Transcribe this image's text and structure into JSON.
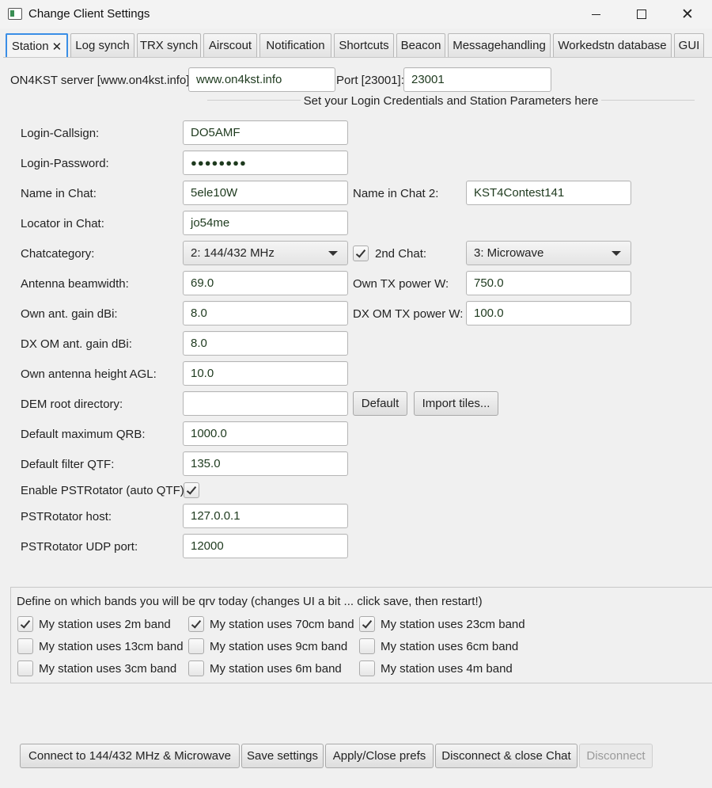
{
  "window": {
    "title": "Change Client Settings"
  },
  "tabs": [
    {
      "label": "Station"
    },
    {
      "label": "Log synch"
    },
    {
      "label": "TRX synch"
    },
    {
      "label": "Airscout"
    },
    {
      "label": "Notification"
    },
    {
      "label": "Shortcuts"
    },
    {
      "label": "Beacon"
    },
    {
      "label": "Messagehandling"
    },
    {
      "label": "Workedstn database"
    },
    {
      "label": "GUI"
    }
  ],
  "server": {
    "server_label": "ON4KST server [www.on4kst.info]:",
    "server_value": "www.on4kst.info",
    "port_label": "Port [23001]:",
    "port_value": "23001"
  },
  "section_title": "Set your Login Credentials and Station Parameters here",
  "fields": {
    "login_callsign": {
      "label": "Login-Callsign:",
      "value": "DO5AMF"
    },
    "login_password": {
      "label": "Login-Password:",
      "value": "●●●●●●●●"
    },
    "name_in_chat": {
      "label": "Name in Chat:",
      "value": "5ele10W"
    },
    "name_in_chat2": {
      "label": "Name in Chat 2:",
      "value": "KST4Contest141"
    },
    "locator": {
      "label": "Locator in Chat:",
      "value": "jo54me"
    },
    "chatcategory": {
      "label": "Chatcategory:",
      "value": "2: 144/432 MHz"
    },
    "second_chat": {
      "label": "2nd Chat:",
      "checked": true,
      "value": "3: Microwave"
    },
    "beamwidth": {
      "label": "Antenna beamwidth:",
      "value": "69.0"
    },
    "own_tx_power": {
      "label": "Own TX power W:",
      "value": "750.0"
    },
    "own_gain": {
      "label": "Own ant. gain dBi:",
      "value": "8.0"
    },
    "dx_tx_power": {
      "label": "DX OM TX power W:",
      "value": "100.0"
    },
    "dx_gain": {
      "label": "DX OM ant. gain dBi:",
      "value": "8.0"
    },
    "antenna_height": {
      "label": "Own antenna height AGL:",
      "value": "10.0"
    },
    "dem_dir": {
      "label": "DEM root directory:",
      "value": "",
      "default_btn": "Default",
      "import_btn": "Import tiles..."
    },
    "max_qrb": {
      "label": "Default maximum QRB:",
      "value": "1000.0"
    },
    "filter_qtf": {
      "label": "Default filter QTF:",
      "value": "135.0"
    },
    "pstrotator_enable": {
      "label": "Enable PSTRotator (auto QTF):",
      "checked": true
    },
    "pstrotator_host": {
      "label": "PSTRotator host:",
      "value": "127.0.0.1"
    },
    "pstrotator_port": {
      "label": "PSTRotator UDP port:",
      "value": "12000"
    }
  },
  "bands": {
    "title": "Define on which bands you will be qrv today (changes UI a bit ... click save, then restart!)",
    "items": [
      {
        "label": "My station uses 2m band",
        "checked": true
      },
      {
        "label": "My station uses 70cm band",
        "checked": true
      },
      {
        "label": "My station uses 23cm band",
        "checked": true
      },
      {
        "label": "My station uses 13cm band",
        "checked": false
      },
      {
        "label": "My station uses 9cm band",
        "checked": false
      },
      {
        "label": "My station uses 6cm band",
        "checked": false
      },
      {
        "label": "My station uses 3cm band",
        "checked": false
      },
      {
        "label": "My station uses 6m band",
        "checked": false
      },
      {
        "label": "My station uses 4m band",
        "checked": false
      }
    ]
  },
  "actions": {
    "connect": "Connect to 144/432 MHz & Microwave",
    "save": "Save settings",
    "apply": "Apply/Close prefs",
    "disconnect_close": "Disconnect & close Chat",
    "disconnect": "Disconnect"
  }
}
